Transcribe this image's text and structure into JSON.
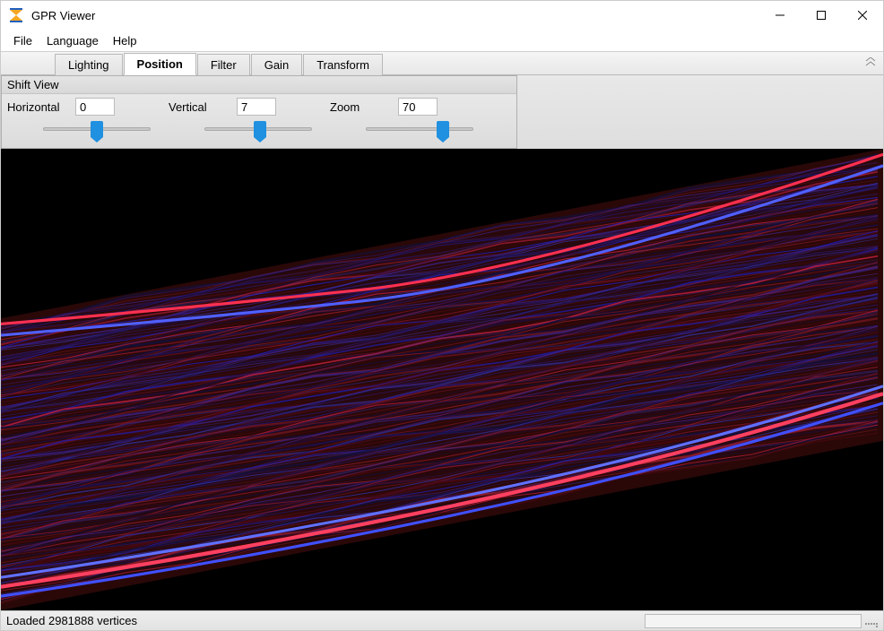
{
  "window": {
    "title": "GPR Viewer"
  },
  "menu": {
    "items": [
      "File",
      "Language",
      "Help"
    ]
  },
  "tabs": {
    "items": [
      "Lighting",
      "Position",
      "Filter",
      "Gain",
      "Transform"
    ],
    "active": "Position"
  },
  "panel": {
    "title": "Shift View",
    "controls": {
      "horizontal": {
        "label": "Horizontal",
        "value": "0",
        "pos": 50
      },
      "vertical": {
        "label": "Vertical",
        "value": "7",
        "pos": 52
      },
      "zoom": {
        "label": "Zoom",
        "value": "70",
        "pos": 72
      }
    }
  },
  "statusbar": {
    "text": "Loaded 2981888 vertices"
  }
}
